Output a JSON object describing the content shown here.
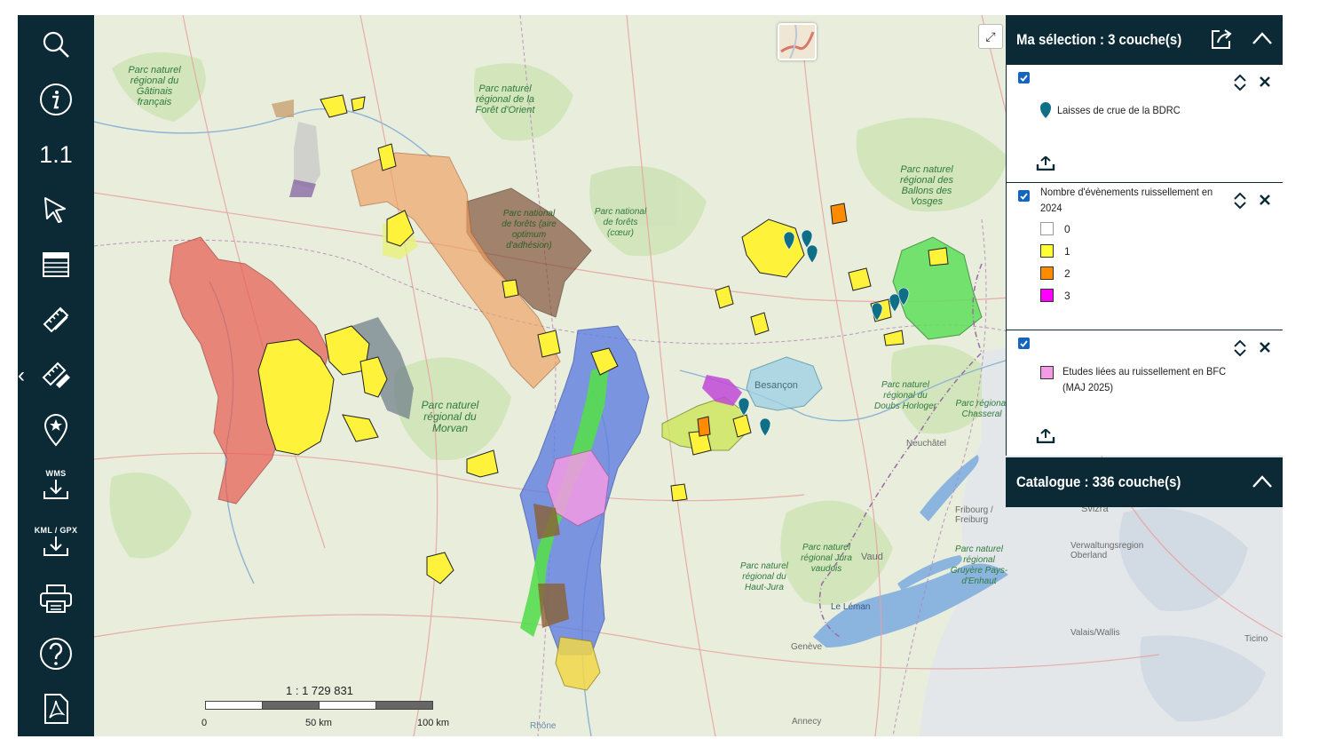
{
  "toolbar": {
    "search_icon": "search-icon",
    "info_icon": "info-icon",
    "scale_text": "1.1",
    "select_icon": "cursor-arrow-icon",
    "table_icon": "attribute-table-icon",
    "measure_icon": "ruler-icon",
    "measure_area_icon": "ruler-pen-icon",
    "locate_icon": "map-pin-star-icon",
    "wms_label": "WMS",
    "kml_label": "KML / GPX",
    "print_icon": "printer-icon",
    "help_icon": "help-icon",
    "pdf_icon": "pdf-icon"
  },
  "map": {
    "scale_ratio": "1 : 1 729 831",
    "scale_labels": [
      "0",
      "50 km",
      "100 km"
    ],
    "zoom_in": "+",
    "zoom_out": "−",
    "fullscreen": "⤢",
    "labels": {
      "gatinais": "Parc naturel régional du Gâtinais français",
      "foret_orient": "Parc naturel régional de la Forêt d'Orient",
      "pn_forets_adhesion": "Parc national de forêts (aire optimum d'adhésion)",
      "pn_forets_coeur": "Parc national de forêts (cœur)",
      "ballons_vosges": "Parc naturel régional des Ballons des Vosges",
      "morvan": "Parc naturel régional du Morvan",
      "besancon": "Besançon",
      "doubs_horloger": "Parc naturel régional du Doubs Horloger",
      "chasseral": "Parc régional Chasseral",
      "neuchatel": "Neuchâtel",
      "fribourg": "Fribourg / Freiburg",
      "svizra": "Svizra",
      "oberland": "Verwaltungsregion Oberland",
      "gruyere": "Parc naturel régional Gruyère Pays-d'Enhaut",
      "jura_vaudois": "Parc naturel régional Jura vaudois",
      "vaud": "Vaud",
      "haut_jura": "Parc naturel régional du Haut-Jura",
      "leman": "Le Léman",
      "geneve": "Genève",
      "valais": "Valais/Wallis",
      "ticino": "Ticino",
      "annecy": "Annecy",
      "rhone": "Rhône"
    }
  },
  "panel": {
    "selection_title": "Ma sélection : 3 couche(s)",
    "share_icon": "share-icon",
    "collapse_icon": "chevron-up-icon",
    "layers": [
      {
        "name": "Laisses de crue de la BDRC",
        "checked": true
      },
      {
        "name": "Nombre d'évènements ruissellement en 2024",
        "checked": true,
        "legend": [
          {
            "label": "0",
            "color": "#ffffff"
          },
          {
            "label": "1",
            "color": "#ffff33"
          },
          {
            "label": "2",
            "color": "#ff8c00"
          },
          {
            "label": "3",
            "color": "#ff00ff"
          }
        ]
      },
      {
        "name": "Etudes liées au ruissellement en BFC (MAJ 2025)",
        "checked": true,
        "color": "#f59ae6"
      }
    ],
    "catalogue_title": "Catalogue : 336 couche(s)"
  },
  "colors": {
    "toolbar_bg": "#0b2a36",
    "accent": "#1565c0",
    "marker": "#0f6f86"
  }
}
